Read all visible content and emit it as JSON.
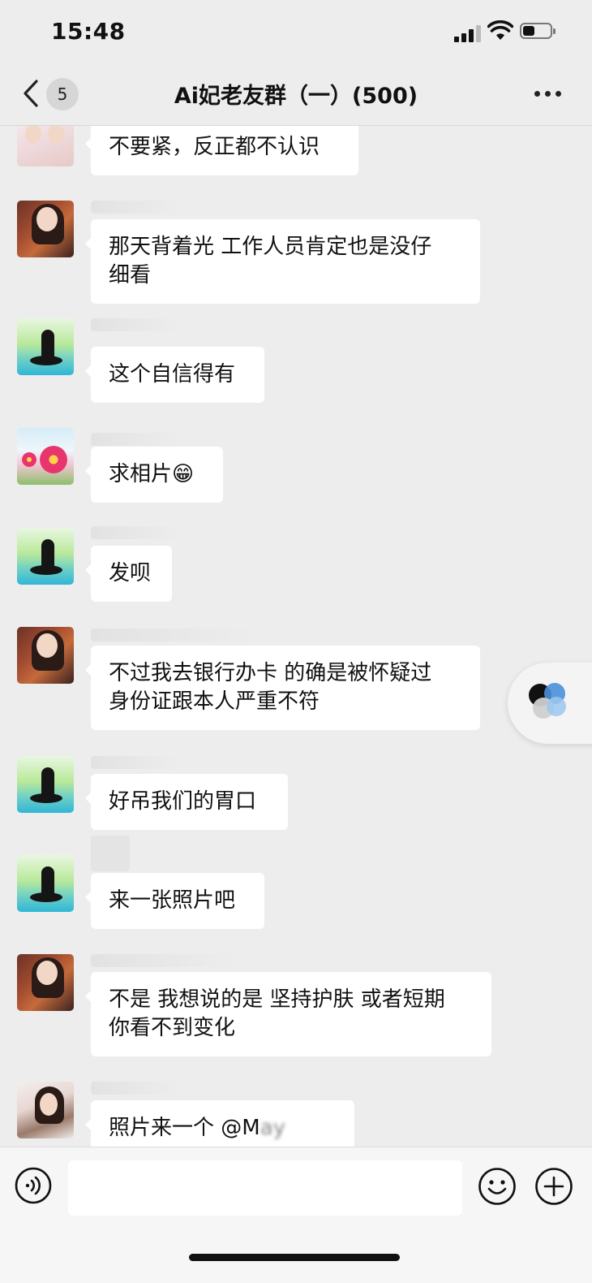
{
  "status_bar": {
    "time": "15:48",
    "battery_level": 0.45
  },
  "nav": {
    "back_badge": "5",
    "title": "Ai妃老友群（一）(500)"
  },
  "messages": [
    {
      "text": "不要紧，反正都不认识"
    },
    {
      "text_line1": "那天背着光 工作人员肯定也是没仔",
      "text_line2": "细看"
    },
    {
      "text": "这个自信得有"
    },
    {
      "text": "求相片",
      "emoji": "😁"
    },
    {
      "text": "发呗"
    },
    {
      "text_line1": "不过我去银行办卡 的确是被怀疑过",
      "text_line2": "身份证跟本人严重不符"
    },
    {
      "text": "好吊我们的胃口"
    },
    {
      "text": "来一张照片吧"
    },
    {
      "text_line1": "不是 我想说的是 坚持护肤 或者短期",
      "text_line2": "你看不到变化"
    },
    {
      "text": "照片来一个 @M",
      "redacted": "ay"
    }
  ],
  "icons": [
    "back-chevron-icon",
    "more-dots-icon",
    "floating-bubble-icon",
    "voice-icon",
    "emoji-icon",
    "plus-icon"
  ]
}
